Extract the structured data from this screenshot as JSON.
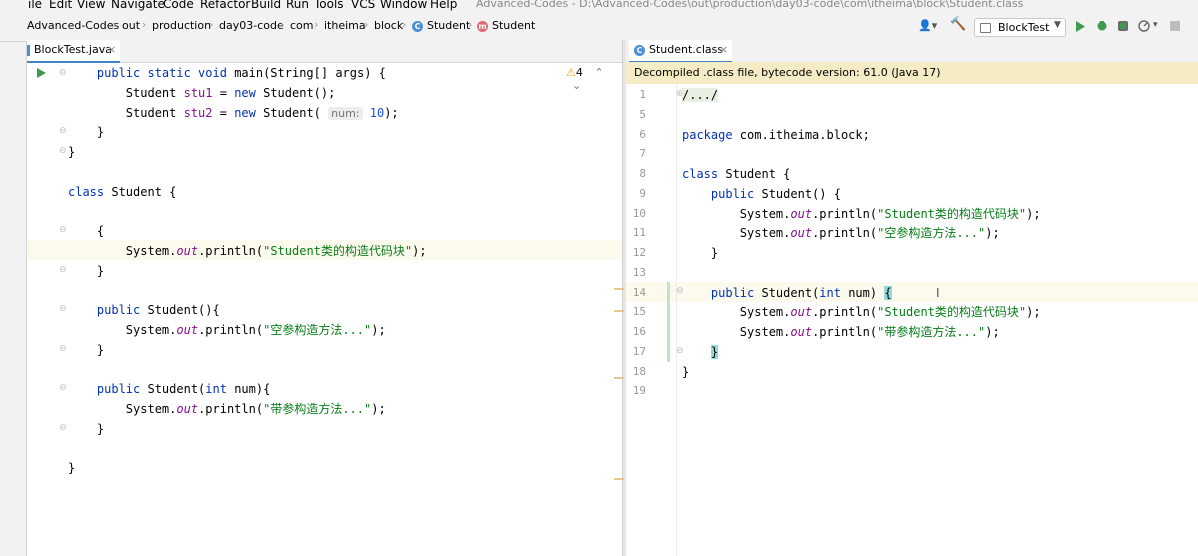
{
  "menu": {
    "items": [
      "ile",
      "Edit",
      "View",
      "Navigate",
      "Code",
      "Refactor",
      "Build",
      "Run",
      "Tools",
      "VCS",
      "Window",
      "Help"
    ],
    "window_title": "Advanced-Codes - D:\\Advanced-Codes\\out\\production\\day03-code\\com\\itheima\\block\\Student.class"
  },
  "breadcrumbs": [
    "Advanced-Codes",
    "out",
    "production",
    "day03-code",
    "com",
    "itheima",
    "block",
    "Student",
    "Student"
  ],
  "toolbar": {
    "run_config": "BlockTest"
  },
  "left_editor": {
    "tab_label": "BlockTest.java",
    "warnings": "4",
    "hint_label": "num:",
    "lines": [
      [
        {
          "t": "    "
        },
        {
          "t": "public static void ",
          "c": "kw"
        },
        {
          "t": "main(String[] args) {"
        }
      ],
      [
        {
          "t": "        Student "
        },
        {
          "t": "stu1",
          "c": "var"
        },
        {
          "t": " = "
        },
        {
          "t": "new ",
          "c": "kw"
        },
        {
          "t": "Student();"
        }
      ],
      [
        {
          "t": "        Student "
        },
        {
          "t": "stu2",
          "c": "var"
        },
        {
          "t": " = "
        },
        {
          "t": "new ",
          "c": "kw"
        },
        {
          "t": "Student( "
        },
        {
          "hint": true
        },
        {
          "t": " "
        },
        {
          "t": "10",
          "c": "num"
        },
        {
          "t": ");"
        }
      ],
      [
        {
          "t": "    }"
        }
      ],
      [
        {
          "t": "}"
        }
      ],
      [
        {
          "t": ""
        }
      ],
      [
        {
          "t": "class ",
          "c": "kw"
        },
        {
          "t": "Student {"
        }
      ],
      [
        {
          "t": ""
        }
      ],
      [
        {
          "t": "    {"
        }
      ],
      [
        {
          "t": "        System."
        },
        {
          "t": "out",
          "c": "fld"
        },
        {
          "t": ".println("
        },
        {
          "t": "\"Student类的构造代码块\"",
          "c": "str"
        },
        {
          "t": ");"
        }
      ],
      [
        {
          "t": "    }"
        }
      ],
      [
        {
          "t": ""
        }
      ],
      [
        {
          "t": "    "
        },
        {
          "t": "public ",
          "c": "kw"
        },
        {
          "t": "Student(){"
        }
      ],
      [
        {
          "t": "        System."
        },
        {
          "t": "out",
          "c": "fld"
        },
        {
          "t": ".println("
        },
        {
          "t": "\"空参构造方法...\"",
          "c": "str"
        },
        {
          "t": ");"
        }
      ],
      [
        {
          "t": "    }"
        }
      ],
      [
        {
          "t": ""
        }
      ],
      [
        {
          "t": "    "
        },
        {
          "t": "public ",
          "c": "kw"
        },
        {
          "t": "Student("
        },
        {
          "t": "int ",
          "c": "kw"
        },
        {
          "t": "num){"
        }
      ],
      [
        {
          "t": "        System."
        },
        {
          "t": "out",
          "c": "fld"
        },
        {
          "t": ".println("
        },
        {
          "t": "\"带参构造方法...\"",
          "c": "str"
        },
        {
          "t": ");"
        }
      ],
      [
        {
          "t": "    }"
        }
      ],
      [
        {
          "t": ""
        }
      ],
      [
        {
          "t": "}"
        }
      ]
    ]
  },
  "right_editor": {
    "tab_label": "Student.class",
    "banner": "Decompiled .class file, bytecode version: 61.0 (Java 17)",
    "line_numbers": [
      "1",
      "5",
      "6",
      "7",
      "8",
      "9",
      "10",
      "11",
      "12",
      "13",
      "14",
      "15",
      "16",
      "17",
      "18",
      "19"
    ],
    "lines": [
      [
        {
          "t": "/.../",
          "c": "hl"
        }
      ],
      [
        {
          "t": ""
        }
      ],
      [
        {
          "t": "package ",
          "c": "kw"
        },
        {
          "t": "com.itheima.block;"
        }
      ],
      [
        {
          "t": ""
        }
      ],
      [
        {
          "t": "class ",
          "c": "kw"
        },
        {
          "t": "Student {"
        }
      ],
      [
        {
          "t": "    "
        },
        {
          "t": "public ",
          "c": "kw"
        },
        {
          "t": "Student() {"
        }
      ],
      [
        {
          "t": "        System."
        },
        {
          "t": "out",
          "c": "fld"
        },
        {
          "t": ".println("
        },
        {
          "t": "\"Student类的构造代码块\"",
          "c": "str"
        },
        {
          "t": ");"
        }
      ],
      [
        {
          "t": "        System."
        },
        {
          "t": "out",
          "c": "fld"
        },
        {
          "t": ".println("
        },
        {
          "t": "\"空参构造方法...\"",
          "c": "str"
        },
        {
          "t": ");"
        }
      ],
      [
        {
          "t": "    }"
        }
      ],
      [
        {
          "t": ""
        }
      ],
      [
        {
          "t": "    "
        },
        {
          "t": "public ",
          "c": "kw"
        },
        {
          "t": "Student("
        },
        {
          "t": "int ",
          "c": "kw"
        },
        {
          "t": "num) "
        },
        {
          "t": "{",
          "c": "brace"
        }
      ],
      [
        {
          "t": "        System."
        },
        {
          "t": "out",
          "c": "fld"
        },
        {
          "t": ".println("
        },
        {
          "t": "\"Student类的构造代码块\"",
          "c": "str"
        },
        {
          "t": ");"
        }
      ],
      [
        {
          "t": "        System."
        },
        {
          "t": "out",
          "c": "fld"
        },
        {
          "t": ".println("
        },
        {
          "t": "\"带参构造方法...\"",
          "c": "str"
        },
        {
          "t": ");"
        }
      ],
      [
        {
          "t": "    "
        },
        {
          "t": "}",
          "c": "brace"
        }
      ],
      [
        {
          "t": "}"
        }
      ],
      [
        {
          "t": ""
        }
      ]
    ]
  },
  "colors": {
    "accent": "#4083c9",
    "keyword": "#0033b3",
    "string": "#067d17",
    "banner_bg": "#f5ecc5",
    "caret_line": "#fcfaed"
  }
}
